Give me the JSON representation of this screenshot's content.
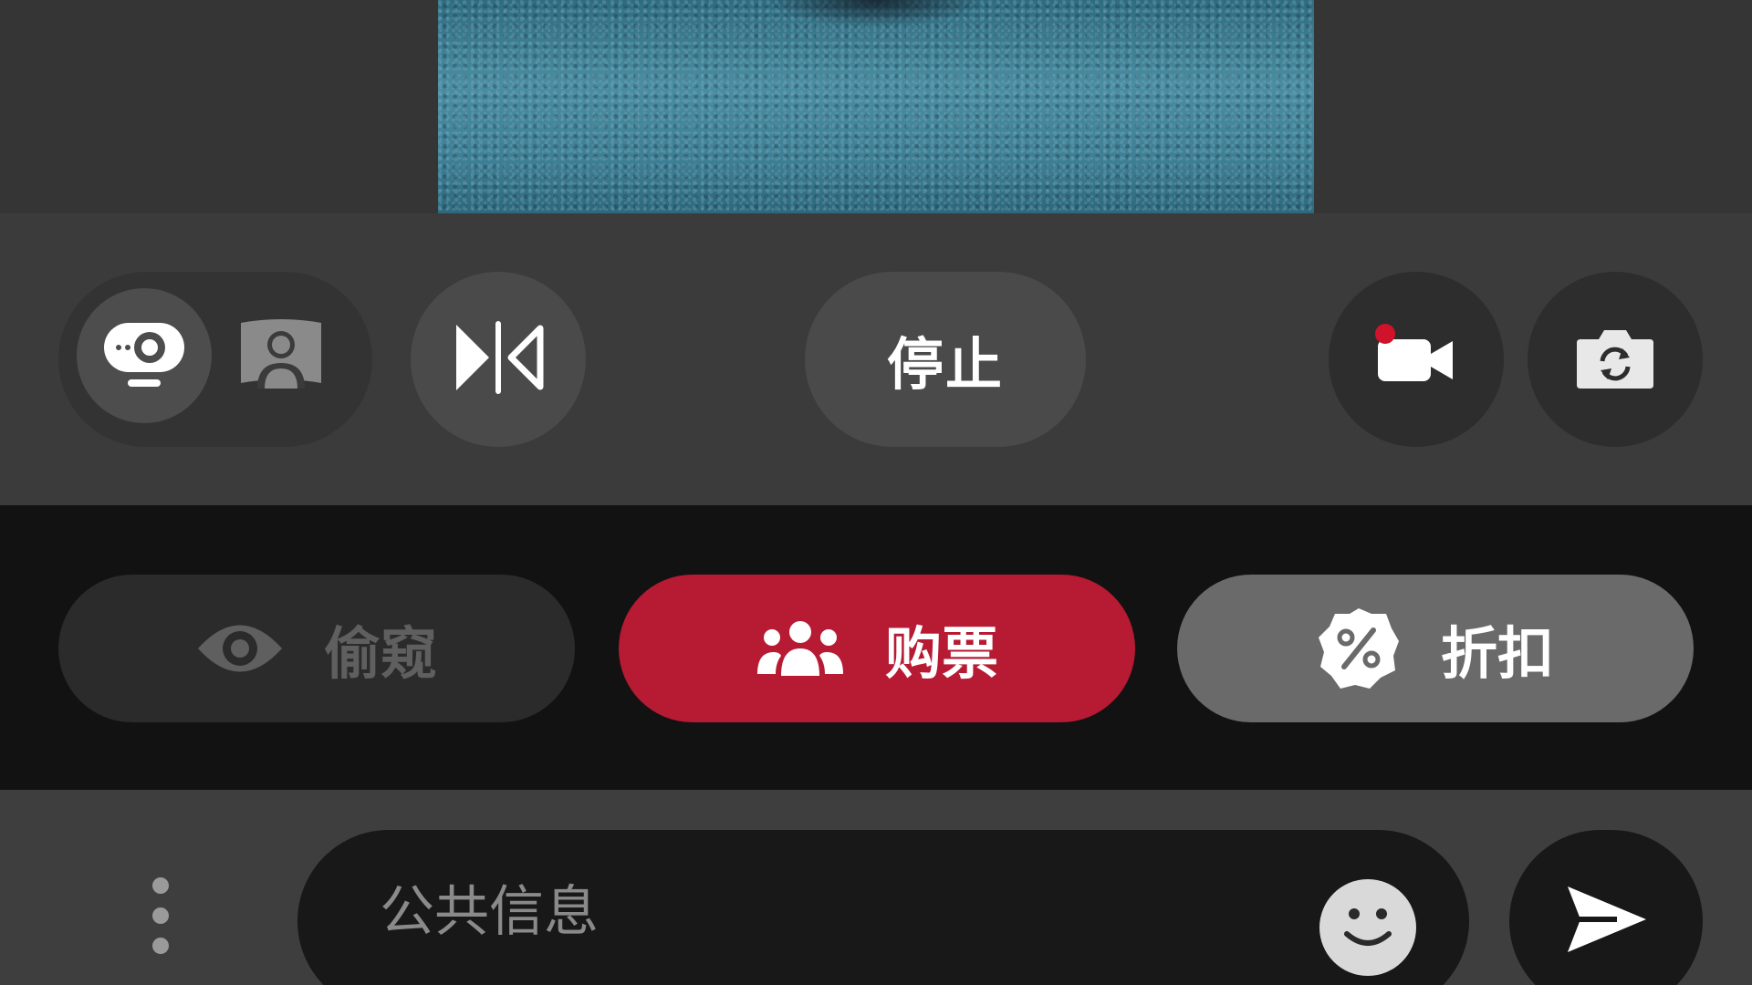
{
  "camera_controls": {
    "mode_toggle": {
      "active_icon": "webcam-icon",
      "inactive_icon": "portrait-icon"
    },
    "mirror_icon": "mirror-flip-icon",
    "stop_label": "停止",
    "record_icon": "record-video-icon",
    "switch_camera_icon": "switch-camera-icon"
  },
  "actions": {
    "peek": {
      "label": "偷窥",
      "icon": "eye-icon"
    },
    "tickets": {
      "label": "购票",
      "icon": "group-icon"
    },
    "discount": {
      "label": "折扣",
      "icon": "percent-badge-icon"
    }
  },
  "chat": {
    "more_icon": "more-vertical-icon",
    "placeholder": "公共信息",
    "emoji_icon": "emoji-icon",
    "send_icon": "send-icon"
  },
  "colors": {
    "accent": "#b71a33",
    "record_indicator": "#d0132b"
  }
}
